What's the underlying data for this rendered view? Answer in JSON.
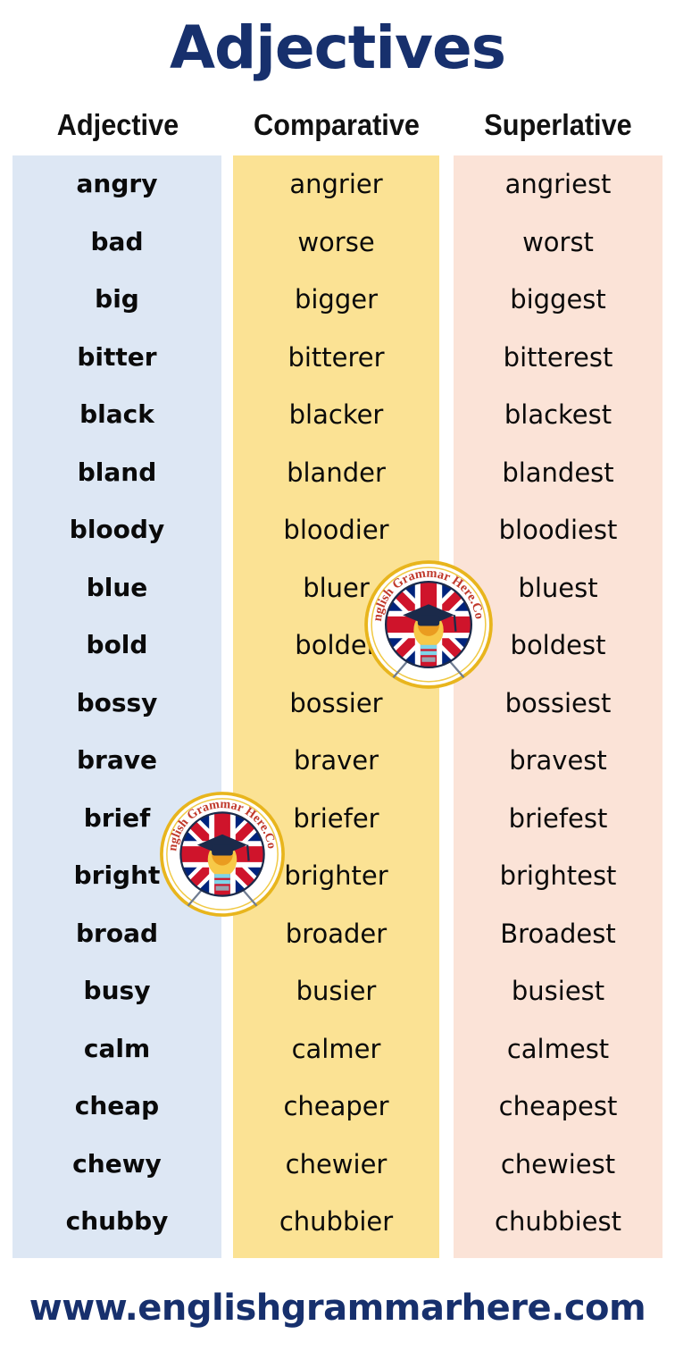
{
  "title": "Adjectives",
  "columns": {
    "adjective": "Adjective",
    "comparative": "Comparative",
    "superlative": "Superlative"
  },
  "colors": {
    "title_navy": "#17306d",
    "adjective_bg": "#dde7f4",
    "comparative_bg": "#fbe294",
    "superlative_bg": "#fbe3d7",
    "cell_text": "#0a0a0a"
  },
  "rows": [
    {
      "adjective": "angry",
      "comparative": "angrier",
      "superlative": "angriest"
    },
    {
      "adjective": "bad",
      "comparative": "worse",
      "superlative": "worst"
    },
    {
      "adjective": "big",
      "comparative": "bigger",
      "superlative": "biggest"
    },
    {
      "adjective": "bitter",
      "comparative": "bitterer",
      "superlative": "bitterest"
    },
    {
      "adjective": "black",
      "comparative": "blacker",
      "superlative": "blackest"
    },
    {
      "adjective": "bland",
      "comparative": "blander",
      "superlative": "blandest"
    },
    {
      "adjective": "bloody",
      "comparative": "bloodier",
      "superlative": "bloodiest"
    },
    {
      "adjective": "blue",
      "comparative": "bluer",
      "superlative": "bluest"
    },
    {
      "adjective": "bold",
      "comparative": "bolder",
      "superlative": "boldest"
    },
    {
      "adjective": "bossy",
      "comparative": "bossier",
      "superlative": "bossiest"
    },
    {
      "adjective": "brave",
      "comparative": "braver",
      "superlative": "bravest"
    },
    {
      "adjective": "brief",
      "comparative": "briefer",
      "superlative": "briefest"
    },
    {
      "adjective": "bright",
      "comparative": "brighter",
      "superlative": "brightest"
    },
    {
      "adjective": "broad",
      "comparative": "broader",
      "superlative": "Broadest"
    },
    {
      "adjective": "busy",
      "comparative": "busier",
      "superlative": "busiest"
    },
    {
      "adjective": "calm",
      "comparative": "calmer",
      "superlative": "calmest"
    },
    {
      "adjective": "cheap",
      "comparative": "cheaper",
      "superlative": "cheapest"
    },
    {
      "adjective": "chewy",
      "comparative": "chewier",
      "superlative": "chewiest"
    },
    {
      "adjective": "chubby",
      "comparative": "chubbier",
      "superlative": "chubbiest"
    }
  ],
  "footer": {
    "url": "www.englishgrammarhere.com"
  },
  "watermarks": [
    {
      "text": "English Grammar Here.Com",
      "icon": "graduation-cap-lightbulb-union-jack-badge"
    },
    {
      "text": "English Grammar Here.Com",
      "icon": "graduation-cap-lightbulb-union-jack-badge"
    }
  ]
}
